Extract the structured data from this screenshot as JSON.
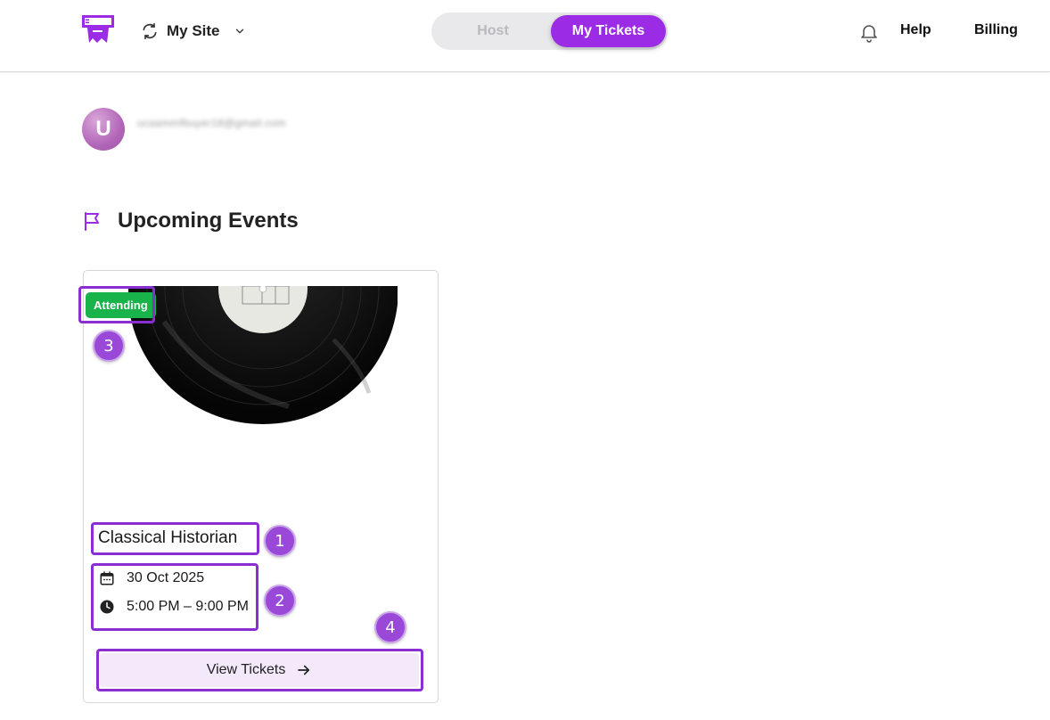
{
  "header": {
    "site_selector": {
      "label": "My Site",
      "icon": "swap-arrows-icon"
    },
    "mode_toggle": {
      "host_label": "Host",
      "tickets_label": "My Tickets",
      "active": "My Tickets"
    },
    "help_label": "Help",
    "billing_label": "Billing"
  },
  "user": {
    "avatar_initial": "U",
    "email": "ucaammfbuyer18@gmail.com"
  },
  "section": {
    "title": "Upcoming Events",
    "icon": "flag-icon"
  },
  "event": {
    "status_badge": "Attending",
    "title": "Classical Historian",
    "date": "30 Oct 2025",
    "time": "5:00 PM – 9:00 PM",
    "button_label": "View Tickets"
  },
  "annotations": [
    "1",
    "2",
    "3",
    "4"
  ],
  "colors": {
    "accent": "#9b2be4",
    "status_green": "#18b34b",
    "button_bg": "#f4e8fb",
    "annotation": "#8a2ed4"
  }
}
